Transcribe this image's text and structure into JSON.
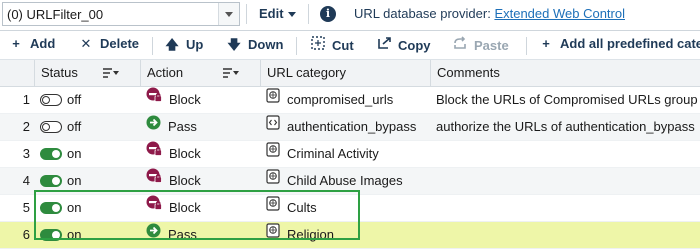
{
  "topbar": {
    "filter_select": "(0) URLFilter_00",
    "edit_label": "Edit",
    "provider_prefix": "URL database provider: ",
    "provider_link": "Extended Web Control"
  },
  "toolbar": {
    "add": "Add",
    "delete": "Delete",
    "up": "Up",
    "down": "Down",
    "cut": "Cut",
    "copy": "Copy",
    "paste": "Paste",
    "add_all": "Add all predefined categ"
  },
  "columns": {
    "status": "Status",
    "action": "Action",
    "category": "URL category",
    "comments": "Comments"
  },
  "rows": [
    {
      "num": "1",
      "status": "off",
      "action": "Block",
      "category": "compromised_urls",
      "cat_icon": "document-icon",
      "comment": "Block the URLs of Compromised URLs group"
    },
    {
      "num": "2",
      "status": "off",
      "action": "Pass",
      "category": "authentication_bypass",
      "cat_icon": "code-document-icon",
      "comment": "authorize the URLs of authentication_bypass"
    },
    {
      "num": "3",
      "status": "on",
      "action": "Block",
      "category": "Criminal Activity",
      "cat_icon": "document-icon",
      "comment": ""
    },
    {
      "num": "4",
      "status": "on",
      "action": "Block",
      "category": "Child Abuse Images",
      "cat_icon": "document-icon",
      "comment": ""
    },
    {
      "num": "5",
      "status": "on",
      "action": "Block",
      "category": "Cults",
      "cat_icon": "document-icon",
      "comment": ""
    },
    {
      "num": "6",
      "status": "on",
      "action": "Pass",
      "category": "Religion",
      "cat_icon": "document-icon",
      "comment": ""
    }
  ],
  "colors": {
    "block": "#8e1a4a",
    "pass": "#2e8b3e",
    "toggle_on": "#2e8b3e",
    "highlight_row": "#eef6a8",
    "selection_border": "#2ea043",
    "link": "#1d6fb8"
  }
}
